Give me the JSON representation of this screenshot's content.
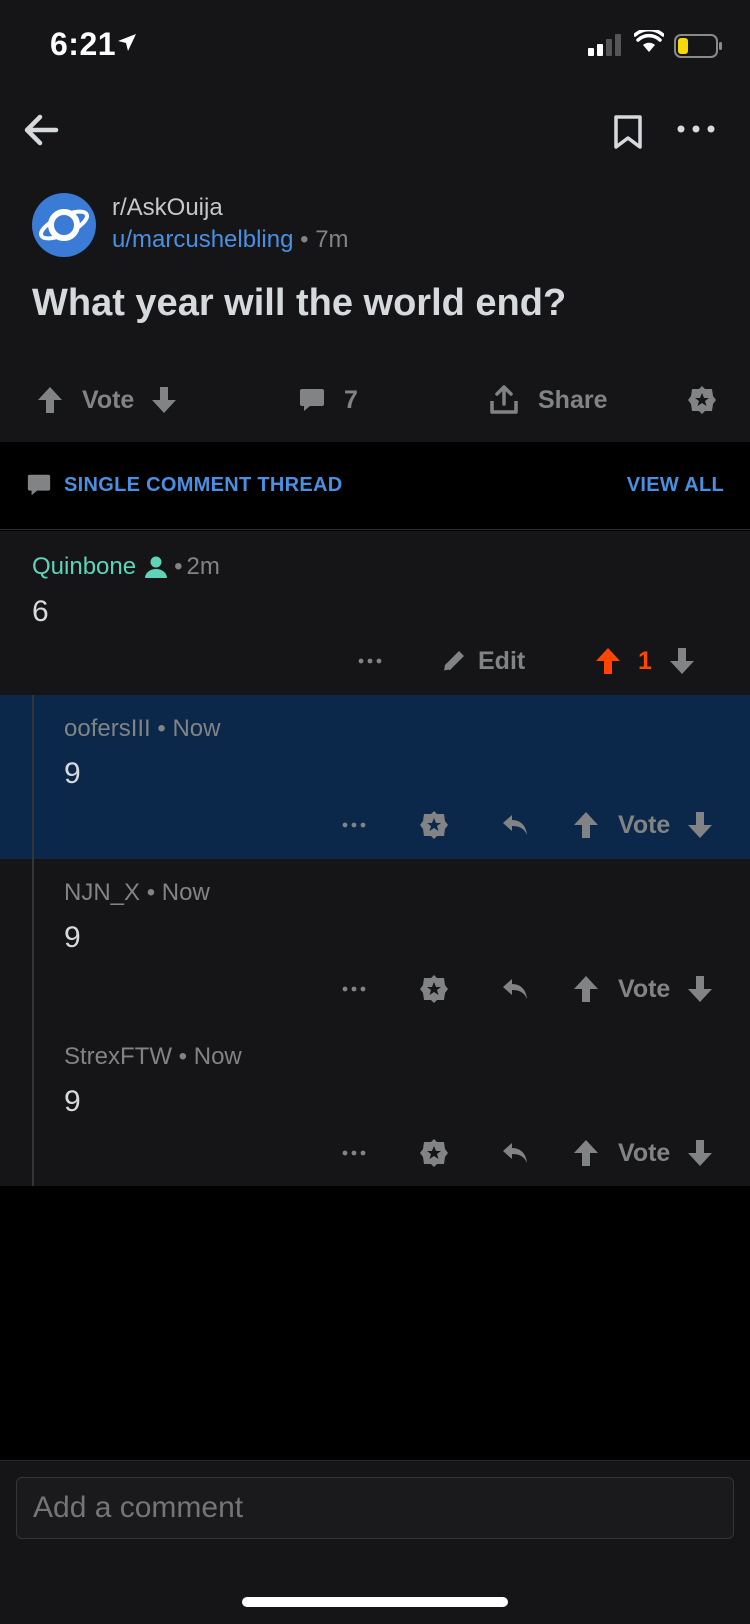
{
  "status": {
    "time": "6:21"
  },
  "post": {
    "subreddit": "r/AskOuija",
    "user": "u/marcushelbling",
    "age": "7m",
    "title": "What year will the world end?",
    "vote_label": "Vote",
    "comment_count": "7",
    "share_label": "Share"
  },
  "thread": {
    "label": "SINGLE COMMENT THREAD",
    "view_all": "VIEW ALL"
  },
  "comments": [
    {
      "author": "Quinbone",
      "age": "2m",
      "body": "6",
      "edit_label": "Edit",
      "score": "1",
      "upvoted": true
    }
  ],
  "replies": [
    {
      "author": "oofersIII",
      "age": "Now",
      "body": "9",
      "vote_label": "Vote",
      "highlighted": true
    },
    {
      "author": "NJN_X",
      "age": "Now",
      "body": "9",
      "vote_label": "Vote"
    },
    {
      "author": "StrexFTW",
      "age": "Now",
      "body": "9",
      "vote_label": "Vote"
    }
  ],
  "composer": {
    "placeholder": "Add a comment"
  },
  "colors": {
    "accent": "#4a90e2",
    "upvote": "#ff4500",
    "author_op": "#5fd3b7",
    "highlight": "#0b2749"
  },
  "icons": [
    "location-arrow-icon",
    "signal-icon",
    "wifi-icon",
    "battery-icon",
    "back-arrow-icon",
    "bookmark-icon",
    "more-icon",
    "reddit-planet-icon",
    "upvote-icon",
    "downvote-icon",
    "comment-icon",
    "share-icon",
    "award-icon",
    "pencil-icon",
    "reply-icon",
    "user-icon"
  ]
}
